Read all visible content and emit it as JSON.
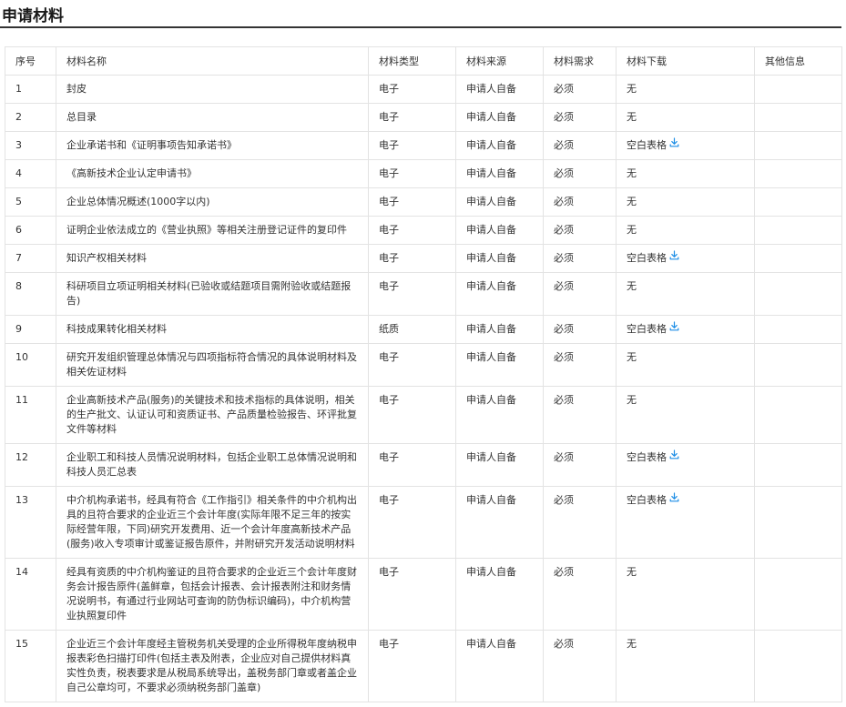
{
  "section": {
    "title": "申请材料"
  },
  "colors": {
    "accent": "#1e8ee6",
    "border": "#e3e3e3",
    "title_rule": "#333333"
  },
  "table": {
    "headers": [
      "序号",
      "材料名称",
      "材料类型",
      "材料来源",
      "材料需求",
      "材料下载",
      "其他信息"
    ],
    "download_icon": "download-icon",
    "rows": [
      {
        "no": "1",
        "name": "封皮",
        "type": "电子",
        "source": "申请人自备",
        "need": "必须",
        "download": "无",
        "other": "",
        "has_download": false
      },
      {
        "no": "2",
        "name": "总目录",
        "type": "电子",
        "source": "申请人自备",
        "need": "必须",
        "download": "无",
        "other": "",
        "has_download": false
      },
      {
        "no": "3",
        "name": "企业承诺书和《证明事项告知承诺书》",
        "type": "电子",
        "source": "申请人自备",
        "need": "必须",
        "download": "空白表格",
        "other": "",
        "has_download": true
      },
      {
        "no": "4",
        "name": "《高新技术企业认定申请书》",
        "type": "电子",
        "source": "申请人自备",
        "need": "必须",
        "download": "无",
        "other": "",
        "has_download": false
      },
      {
        "no": "5",
        "name": "企业总体情况概述(1000字以内)",
        "type": "电子",
        "source": "申请人自备",
        "need": "必须",
        "download": "无",
        "other": "",
        "has_download": false
      },
      {
        "no": "6",
        "name": "证明企业依法成立的《营业执照》等相关注册登记证件的复印件",
        "type": "电子",
        "source": "申请人自备",
        "need": "必须",
        "download": "无",
        "other": "",
        "has_download": false
      },
      {
        "no": "7",
        "name": "知识产权相关材料",
        "type": "电子",
        "source": "申请人自备",
        "need": "必须",
        "download": "空白表格",
        "other": "",
        "has_download": true
      },
      {
        "no": "8",
        "name": "科研项目立项证明相关材料(已验收或结题项目需附验收或结题报告)",
        "type": "电子",
        "source": "申请人自备",
        "need": "必须",
        "download": "无",
        "other": "",
        "has_download": false
      },
      {
        "no": "9",
        "name": "科技成果转化相关材料",
        "type": "纸质",
        "source": "申请人自备",
        "need": "必须",
        "download": "空白表格",
        "other": "",
        "has_download": true
      },
      {
        "no": "10",
        "name": "研究开发组织管理总体情况与四项指标符合情况的具体说明材料及相关佐证材料",
        "type": "电子",
        "source": "申请人自备",
        "need": "必须",
        "download": "无",
        "other": "",
        "has_download": false
      },
      {
        "no": "11",
        "name": "企业高新技术产品(服务)的关键技术和技术指标的具体说明，相关的生产批文、认证认可和资质证书、产品质量检验报告、环评批复文件等材料",
        "type": "电子",
        "source": "申请人自备",
        "need": "必须",
        "download": "无",
        "other": "",
        "has_download": false
      },
      {
        "no": "12",
        "name": "企业职工和科技人员情况说明材料，包括企业职工总体情况说明和科技人员汇总表",
        "type": "电子",
        "source": "申请人自备",
        "need": "必须",
        "download": "空白表格",
        "other": "",
        "has_download": true
      },
      {
        "no": "13",
        "name": "中介机构承诺书，经具有符合《工作指引》相关条件的中介机构出具的且符合要求的企业近三个会计年度(实际年限不足三年的按实际经营年限，下同)研究开发费用、近一个会计年度高新技术产品(服务)收入专项审计或鉴证报告原件，并附研究开发活动说明材料",
        "type": "电子",
        "source": "申请人自备",
        "need": "必须",
        "download": "空白表格",
        "other": "",
        "has_download": true
      },
      {
        "no": "14",
        "name": "经具有资质的中介机构鉴证的且符合要求的企业近三个会计年度财务会计报告原件(盖鲜章，包括会计报表、会计报表附注和财务情况说明书，有通过行业网站可查询的防伪标识编码)，中介机构营业执照复印件",
        "type": "电子",
        "source": "申请人自备",
        "need": "必须",
        "download": "无",
        "other": "",
        "has_download": false
      },
      {
        "no": "15",
        "name": "企业近三个会计年度经主管税务机关受理的企业所得税年度纳税申报表彩色扫描打印件(包括主表及附表，企业应对自己提供材料真实性负责，税表要求是从税局系统导出，盖税务部门章或者盖企业自己公章均可，不要求必须纳税务部门盖章)",
        "type": "电子",
        "source": "申请人自备",
        "need": "必须",
        "download": "无",
        "other": "",
        "has_download": false
      }
    ]
  }
}
